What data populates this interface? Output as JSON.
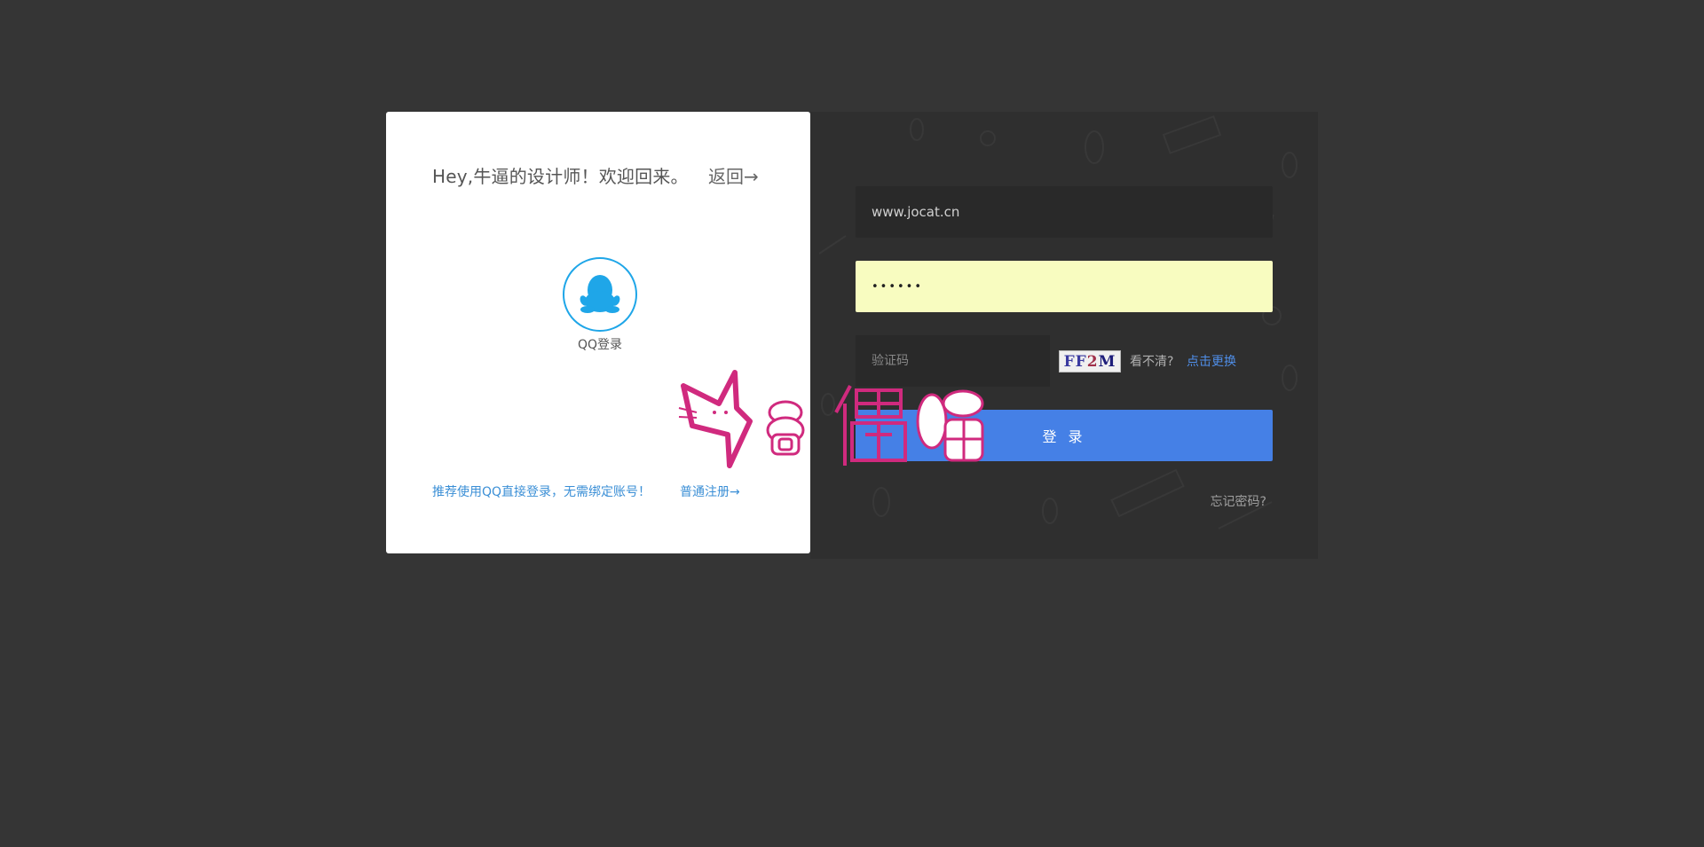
{
  "left_card": {
    "welcome": "Hey,牛逼的设计师！欢迎回来。",
    "back_link": "返回→",
    "qq_label": "QQ登录",
    "recommend": "推荐使用QQ直接登录，无需绑定账号！",
    "register_link": "普通注册→"
  },
  "login_form": {
    "username_value": "www.jocat.cn",
    "password_value": "••••••",
    "captcha_placeholder": "验证码",
    "captcha_chars": [
      "FF",
      "2",
      "M"
    ],
    "cant_see": "看不清?",
    "refresh_link": "点击更换",
    "login_button": "登 录",
    "forgot_link": "忘记密码?"
  },
  "watermark": {
    "text": "偶猫"
  },
  "colors": {
    "background": "#353535",
    "accent_blue": "#4580e6",
    "qq_blue": "#1fa6e8",
    "link_blue": "#3b8fd6",
    "watermark_pink": "#d02a7e"
  },
  "icons": {
    "qq": "qq-penguin-icon"
  }
}
